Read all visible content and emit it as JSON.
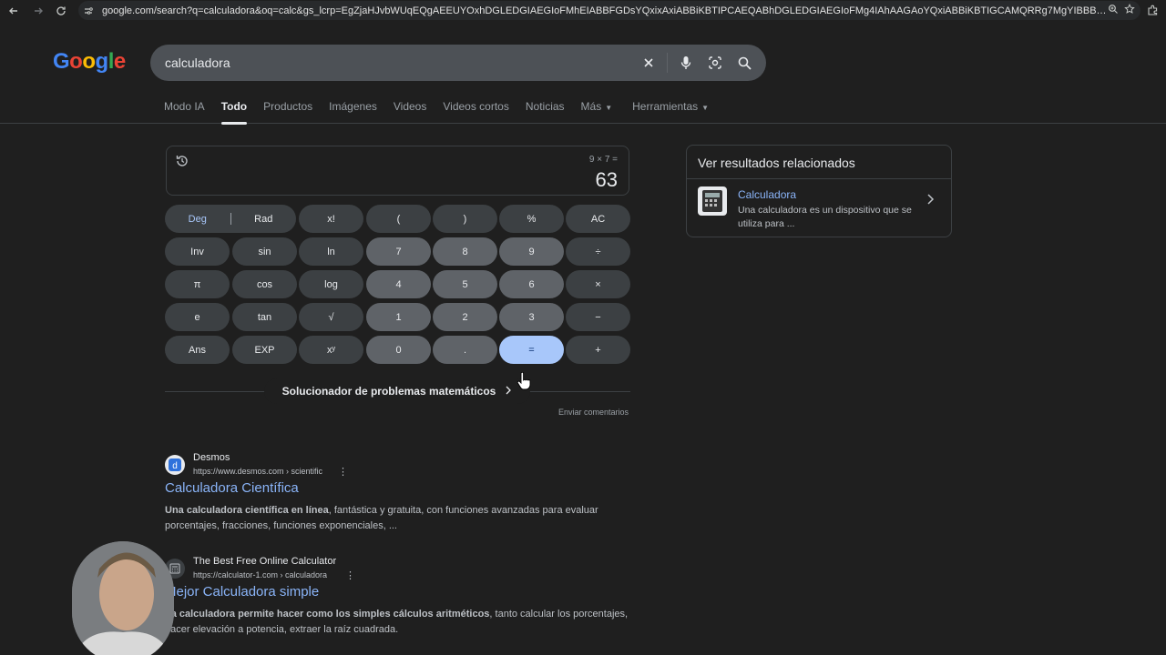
{
  "browser": {
    "url": "google.com/search?q=calculadora&oq=calc&gs_lcrp=EgZjaHJvbWUqEQgAEEUYOxhDGLEDGIAEGIoFMhEIABBFGDsYQxixAxiABBiKBTIPCAEQABhDGLEDGIAEGIoFMg4IAhAAGAoYQxiABBiKBTIGCAMQRRg7MgYIBBBFGDsyBggFEE..."
  },
  "logo": {
    "letters": [
      "G",
      "o",
      "o",
      "g",
      "l",
      "e"
    ],
    "colors": [
      "#4285f4",
      "#ea4335",
      "#fbbc05",
      "#4285f4",
      "#34a853",
      "#ea4335"
    ]
  },
  "search": {
    "query": "calculadora"
  },
  "tabs": [
    {
      "label": "Modo IA"
    },
    {
      "label": "Todo"
    },
    {
      "label": "Productos"
    },
    {
      "label": "Imágenes"
    },
    {
      "label": "Videos"
    },
    {
      "label": "Videos cortos"
    },
    {
      "label": "Noticias"
    },
    {
      "label": "Más"
    },
    {
      "label": "Herramientas"
    }
  ],
  "calculator": {
    "expression": "9 × 7 =",
    "result": "63",
    "deg": "Deg",
    "rad": "Rad",
    "keys": [
      [
        "x!",
        "(",
        ")",
        "%",
        "AC"
      ],
      [
        "Inv",
        "sin",
        "ln",
        "7",
        "8",
        "9",
        "÷"
      ],
      [
        "π",
        "cos",
        "log",
        "4",
        "5",
        "6",
        "×"
      ],
      [
        "e",
        "tan",
        "√",
        "1",
        "2",
        "3",
        "−"
      ],
      [
        "Ans",
        "EXP",
        "xʸ",
        "0",
        ".",
        "=",
        "+"
      ]
    ],
    "solver": "Solucionador de problemas matemáticos",
    "feedback": "Enviar comentarios"
  },
  "results": [
    {
      "site": "Desmos",
      "url": "https://www.desmos.com › scientific",
      "title": "Calculadora Científica",
      "snippet_bold": "Una calculadora científica en línea",
      "snippet_rest": ", fantástica y gratuita, con funciones avanzadas para evaluar porcentajes, fracciones, funciones exponenciales, ..."
    },
    {
      "site": "The Best Free Online Calculator",
      "url": "https://calculator-1.com › calculadora",
      "title": "Mejor Calculadora simple",
      "snippet_bold": "La calculadora permite hacer como los simples cálculos aritméticos",
      "snippet_rest": ", tanto calcular los porcentajes, hacer elevación a potencia, extraer la raíz cuadrada."
    }
  ],
  "side_panel": {
    "heading": "Ver resultados relacionados",
    "title": "Calculadora",
    "description": "Una calculadora es un dispositivo que se utiliza para ..."
  }
}
